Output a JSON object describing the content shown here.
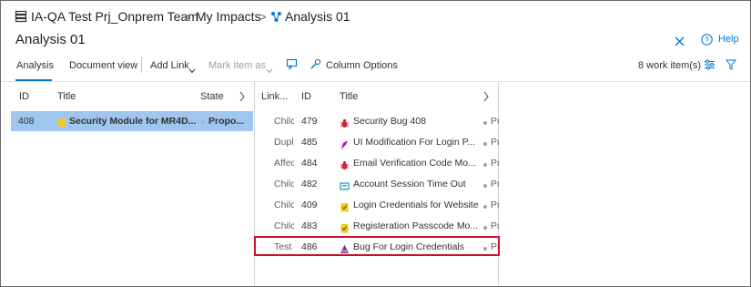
{
  "breadcrumb": {
    "team": "IA-QA Test Prj_Onprem Team",
    "sep1": ">",
    "section": "My Impacts",
    "sep2": ">",
    "current": "Analysis 01"
  },
  "page_title": "Analysis 01",
  "help_label": "Help",
  "toolbar": {
    "tab_analysis": "Analysis",
    "tab_document": "Document view",
    "add_link": "Add Link",
    "mark_item": "Mark item as",
    "column_options": "Column Options",
    "work_items_count": "8 work item(s)"
  },
  "left_table": {
    "headers": {
      "id": "ID",
      "title": "Title",
      "state": "State"
    },
    "rows": [
      {
        "id": "408",
        "title": "Security Module for MR4D...",
        "state": "Propo...",
        "icon": "epic-icon",
        "icon_color": "#f2cb1d"
      }
    ]
  },
  "right_table": {
    "headers": {
      "link": "Link...",
      "id": "ID",
      "title": "Title"
    },
    "rows": [
      {
        "link": "Chilc",
        "id": "479",
        "title": "Security Bug 408",
        "state": "Pr",
        "icon": "bug-icon",
        "icon_color": "#cc293d"
      },
      {
        "link": "Dupl",
        "id": "485",
        "title": "UI Modification For Login P...",
        "state": "Pr",
        "icon": "feature-icon",
        "icon_color": "#c500c2"
      },
      {
        "link": "Affec",
        "id": "484",
        "title": "Email Verification Code Mo...",
        "state": "Pr",
        "icon": "bug-icon",
        "icon_color": "#cc293d"
      },
      {
        "link": "Chilc",
        "id": "482",
        "title": "Account Session Time Out",
        "state": "Pr",
        "icon": "user-story-icon",
        "icon_color": "#009ccc"
      },
      {
        "link": "Chilc",
        "id": "409",
        "title": "Login Credentials for Website",
        "state": "Pr",
        "icon": "requirement-icon",
        "icon_color": "#f2cb1d"
      },
      {
        "link": "Chilc",
        "id": "483",
        "title": "Registeration Passcode Mo...",
        "state": "Pr",
        "icon": "requirement-icon",
        "icon_color": "#f2cb1d"
      },
      {
        "link": "Test",
        "id": "486",
        "title": "Bug For Login Credentials",
        "state": "Pr",
        "icon": "test-icon",
        "icon_color": "#773b93"
      }
    ]
  }
}
